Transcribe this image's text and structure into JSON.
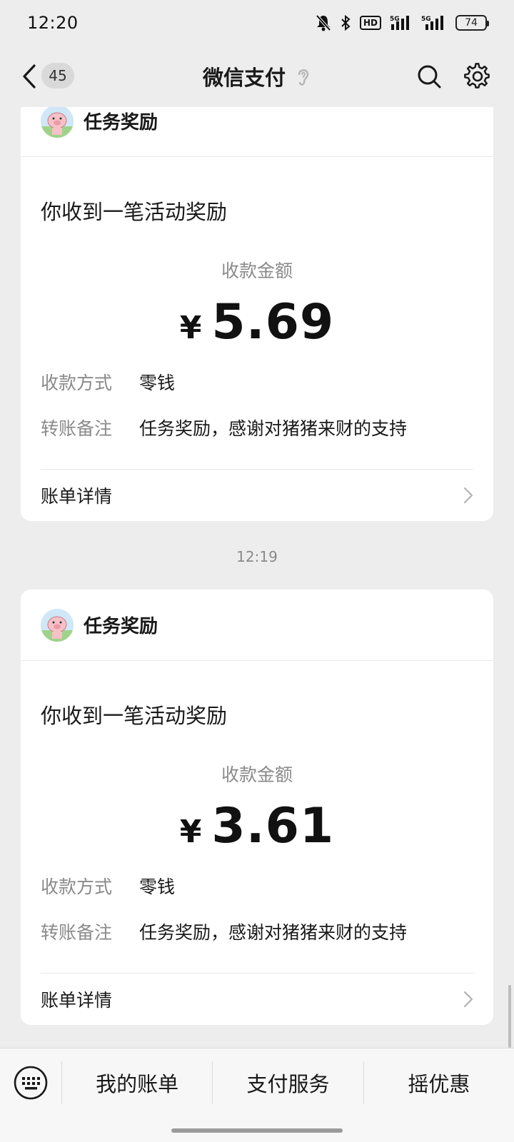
{
  "status_bar": {
    "time": "12:20",
    "icons": [
      "mute-icon",
      "bluetooth-icon",
      "hd-icon",
      "signal-5g-icon",
      "signal-5g-icon"
    ],
    "hd_label": "HD",
    "network_1": "5G",
    "network_2": "5G",
    "battery": "74"
  },
  "nav": {
    "unread_count": "45",
    "title": "微信支付",
    "icons": [
      "back-icon",
      "ear-icon",
      "search-icon",
      "settings-icon"
    ]
  },
  "messages": [
    {
      "sender": "任务奖励",
      "title": "你收到一笔活动奖励",
      "amount_label": "收款金额",
      "currency": "¥",
      "amount": "5.69",
      "rows": [
        {
          "key": "收款方式",
          "value": "零钱"
        },
        {
          "key": "转账备注",
          "value": "任务奖励，感谢对猪猪来财的支持"
        }
      ],
      "detail_label": "账单详情"
    },
    {
      "timestamp": "12:19",
      "sender": "任务奖励",
      "title": "你收到一笔活动奖励",
      "amount_label": "收款金额",
      "currency": "¥",
      "amount": "3.61",
      "rows": [
        {
          "key": "收款方式",
          "value": "零钱"
        },
        {
          "key": "转账备注",
          "value": "任务奖励，感谢对猪猪来财的支持"
        }
      ],
      "detail_label": "账单详情"
    }
  ],
  "bottom_menu": {
    "keyboard_icon": "keyboard-icon",
    "items": [
      "我的账单",
      "支付服务",
      "摇优惠"
    ]
  }
}
